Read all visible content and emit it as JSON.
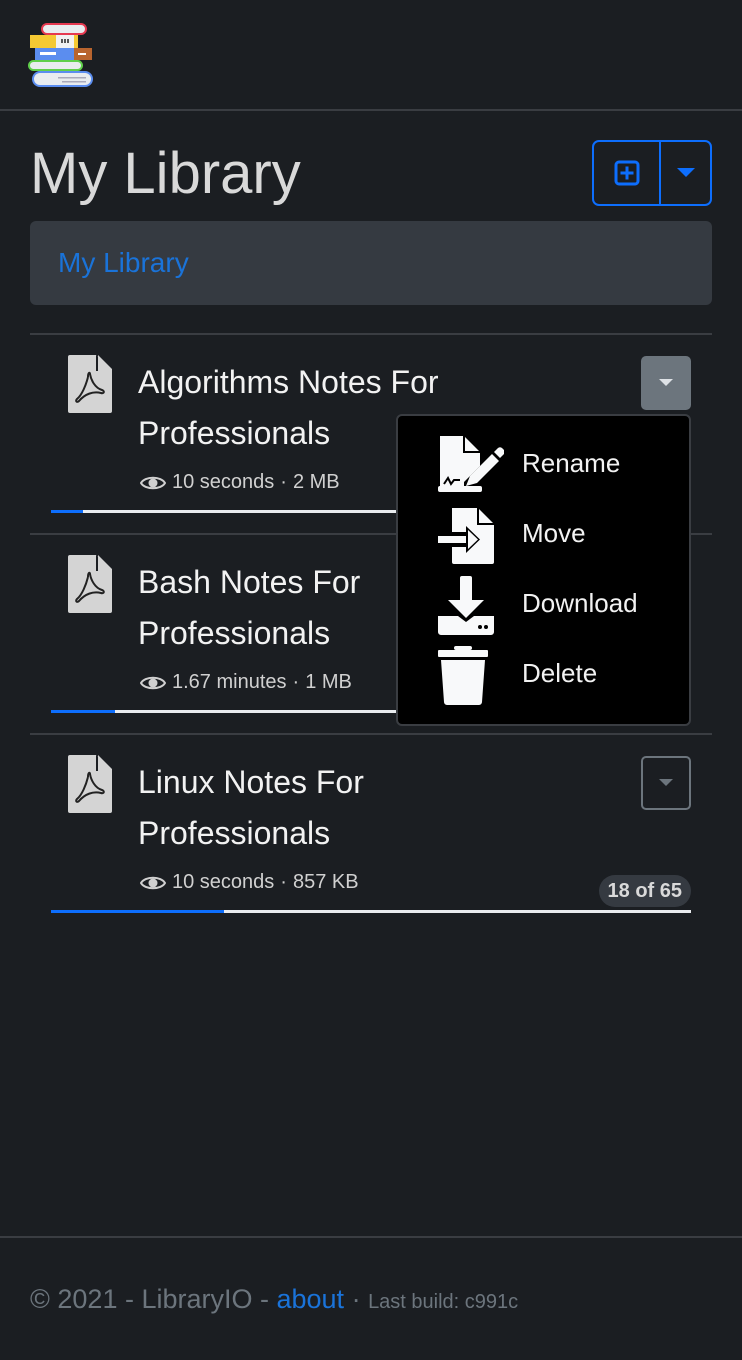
{
  "app": {
    "name": "LibraryIO",
    "logo_icon": "books-stack-icon"
  },
  "header": {
    "title": "My Library",
    "add_icon": "plus-square-icon",
    "menu_icon": "caret-down-icon"
  },
  "breadcrumb": {
    "items": [
      {
        "label": "My Library"
      }
    ]
  },
  "files": [
    {
      "title": "Algorithms Notes For Professionals",
      "meta_icon": "eye-icon",
      "time": "10 seconds",
      "size": "2 MB",
      "separator": "·",
      "progress_percent": 5,
      "menu_open": true
    },
    {
      "title": "Bash Notes For Professionals",
      "meta_icon": "eye-icon",
      "time": "1.67 minutes",
      "size": "1 MB",
      "separator": "·",
      "progress_percent": 10,
      "menu_open": false
    },
    {
      "title": "Linux Notes For Professionals",
      "meta_icon": "eye-icon",
      "time": "10 seconds",
      "size": "857 KB",
      "separator": "·",
      "progress_percent": 27,
      "page_badge": "18 of 65",
      "menu_open": false
    }
  ],
  "dropdown_menu": {
    "items": [
      {
        "label": "Rename",
        "icon": "file-signature-icon"
      },
      {
        "label": "Move",
        "icon": "file-import-icon"
      },
      {
        "label": "Download",
        "icon": "download-icon"
      },
      {
        "label": "Delete",
        "icon": "trash-icon"
      }
    ]
  },
  "footer": {
    "copyright": "© 2021 - LibraryIO - ",
    "about_link": "about",
    "separator": " · ",
    "build": "Last build: c991c"
  },
  "colors": {
    "accent": "#0d6efd",
    "background": "#1b1e22",
    "panel": "#353a41",
    "secondary": "#6c757d"
  }
}
